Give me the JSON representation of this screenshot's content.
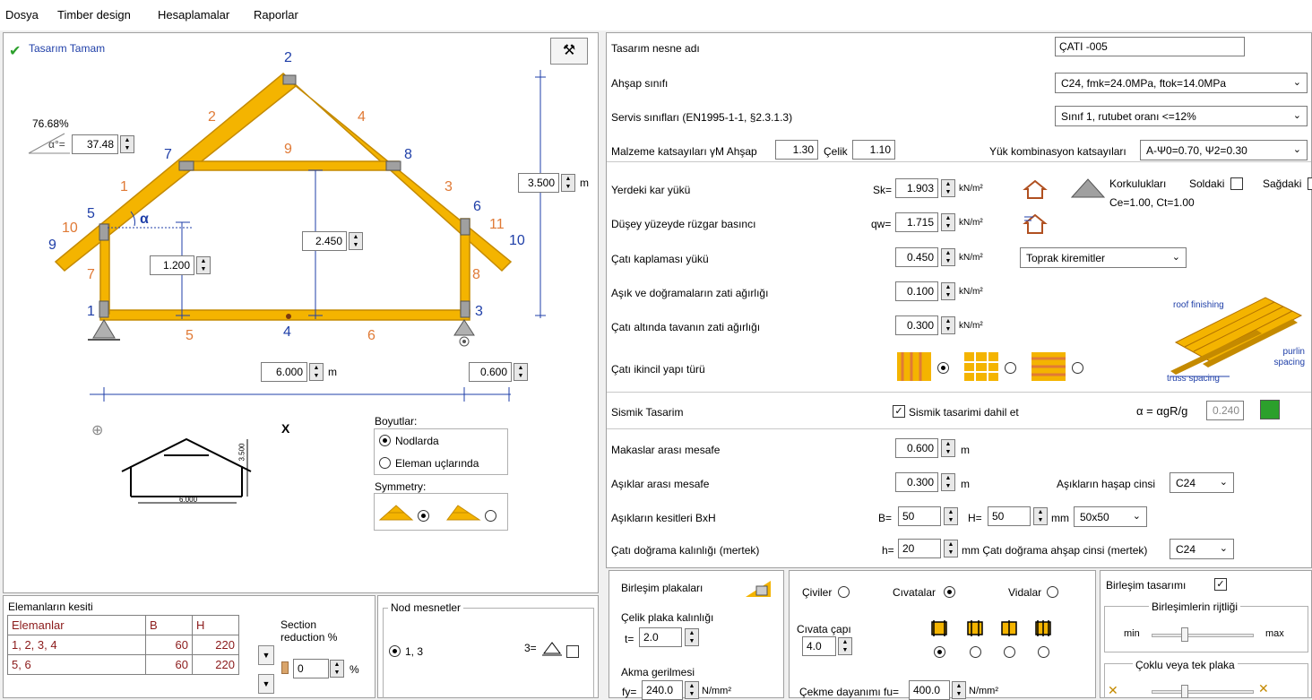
{
  "menu": [
    "Dosya",
    "Timber design",
    "Hesaplamalar",
    "Raporlar"
  ],
  "status": "Tasarım Tamam",
  "drawing": {
    "angle_percent": "76.68%",
    "angle_symbol": "α°=",
    "angle_value": "37.48",
    "alpha": "α",
    "height_total": "3.500",
    "height_mid": "2.450",
    "height_side": "1.200",
    "span": "6.000",
    "overhang": "0.600",
    "unit_m": "m",
    "nodes": [
      "1",
      "2",
      "3",
      "4",
      "5",
      "6",
      "7",
      "8",
      "9",
      "10"
    ],
    "members": [
      "1",
      "2",
      "3",
      "4",
      "5",
      "6",
      "7",
      "8",
      "9",
      "10",
      "11"
    ]
  },
  "preview": {
    "close": "X",
    "dim_h": "3.500",
    "dim_w": "6.000"
  },
  "dimensions_group": {
    "title": "Boyutlar:",
    "opt1": "Nodlarda",
    "opt2": "Eleman uçlarında"
  },
  "symmetry": {
    "title": "Symmetry:"
  },
  "section_table": {
    "title": "Elemanların kesiti",
    "headers": [
      "Elemanlar",
      "B",
      "H"
    ],
    "rows": [
      [
        "1, 2, 3, 4",
        "60",
        "220"
      ],
      [
        "5, 6",
        "60",
        "220"
      ]
    ],
    "reduction_label_1": "Section",
    "reduction_label_2": "reduction %",
    "reduction_value": "0",
    "reduction_unit": "%"
  },
  "supports": {
    "title": "Nod mesnetler",
    "option": "1, 3",
    "node3": "3="
  },
  "form": {
    "design_name_label": "Tasarım nesne adı",
    "design_name_value": "ÇATI -005",
    "wood_class_label": "Ahşap sınıfı",
    "wood_class_value": "C24, fmk=24.0MPa, ftok=14.0MPa",
    "service_label": "Servis sınıfları (EN1995-1-1, §2.3.1.3)",
    "service_value": "Sınıf 1, rutubet oranı <=12%",
    "material_label": "Malzeme katsayıları γM Ahşap",
    "material_wood": "1.30",
    "steel_label": "Çelik",
    "material_steel": "1.10",
    "load_comb_label": "Yük kombinasyon katsayıları",
    "load_comb_value": "A-Ψ0=0.70, Ψ2=0.30",
    "snow_label": "Yerdeki kar yükü",
    "snow_sym": "Sk=",
    "snow_value": "1.903",
    "unit_knm2": "kN/m²",
    "railings": "Korkulukları",
    "left": "Soldaki",
    "right": "Sağdaki",
    "ce_ct": "Ce=1.00, Ct=1.00",
    "wind_label": "Düşey yüzeyde rüzgar basıncı",
    "wind_sym": "qw=",
    "wind_value": "1.715",
    "roofing_label": "Çatı kaplaması yükü",
    "roofing_value": "0.450",
    "roofing_type": "Toprak kiremitler",
    "purlin_self_label": "Aşık ve doğramaların zati ağırlığı",
    "purlin_self_value": "0.100",
    "ceiling_label": "Çatı altında tavanın zati ağırlığı",
    "ceiling_value": "0.300",
    "secondary_label": "Çatı ikincil yapı türü",
    "illus_roof": "roof finishing",
    "illus_purlin": "purlin spacing",
    "illus_truss": "truss spacing",
    "seismic_label": "Sismik Tasarim",
    "seismic_check": "Sismik tasarimi dahil et",
    "seismic_alpha": "α = αgR/g",
    "seismic_value": "0.240",
    "truss_spacing_label": "Makaslar arası mesafe",
    "truss_spacing_value": "0.600",
    "purlin_spacing_label": "Aşıklar arası mesafe",
    "purlin_spacing_value": "0.300",
    "purlin_wood_label": "Aşıkların haşap cinsi",
    "purlin_wood_value": "C24",
    "purlin_section_label": "Aşıkların kesitleri BxH",
    "b_sym": "B=",
    "b_value": "50",
    "h_sym": "H=",
    "h_value": "50",
    "unit_mm": "mm",
    "section_preset": "50x50",
    "rafter_label": "Çatı doğrama kalınlığı (mertek)",
    "rafter_sym": "h=",
    "rafter_value": "20",
    "rafter_wood_label": "mm Çatı doğrama ahşap cinsi (mertek)",
    "rafter_wood_value": "C24"
  },
  "connections": {
    "plates_label": "Birleşim plakaları",
    "plate_thk_label": "Çelik plaka kalınlığı",
    "t_sym": "t=",
    "t_value": "2.0",
    "yield_label": "Akma gerilmesi",
    "fy_sym": "fy=",
    "fy_value": "240.0",
    "unit_nmm2": "N/mm²",
    "nails": "Çiviler",
    "bolts": "Cıvatalar",
    "screws": "Vidalar",
    "bolt_dia_label": "Cıvata çapı",
    "bolt_dia_value": "4.0",
    "tensile_label": "Çekme dayanımı fu=",
    "tensile_value": "400.0",
    "design_label": "Birleşim tasarımı",
    "stiffness_label": "Birleşimlerin rijtliği",
    "min": "min",
    "max": "max",
    "plate_mode": "Çoklu veya tek plaka"
  },
  "colors": {
    "timber": "#f4b400",
    "timber_edge": "#c48a00",
    "member_label": "#e07a36",
    "node_label": "#1f3fa8"
  }
}
